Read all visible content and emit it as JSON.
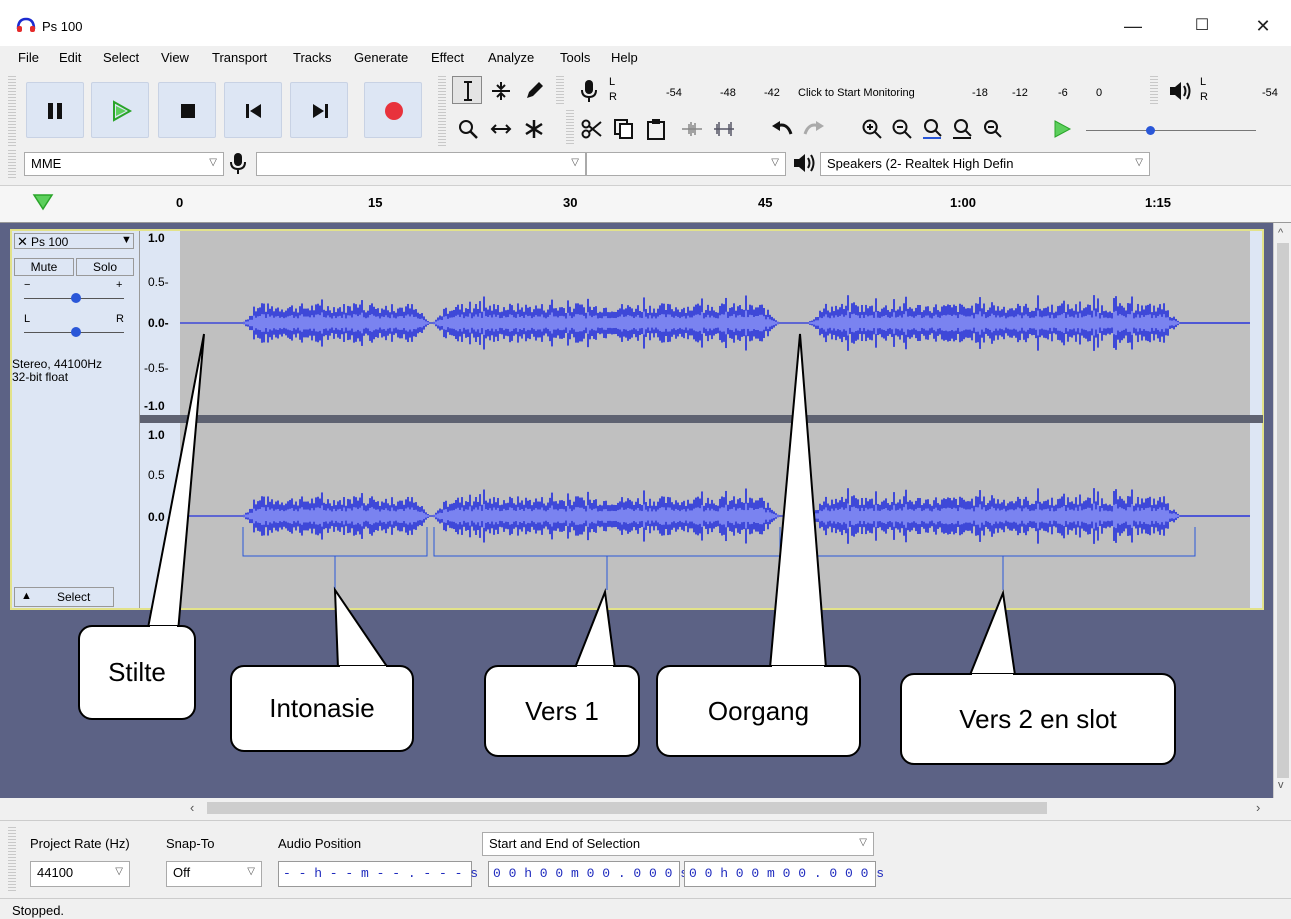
{
  "window": {
    "title": "Ps 100",
    "minimize": "—",
    "maximize": "☐",
    "close": "✕"
  },
  "menu": [
    "File",
    "Edit",
    "Select",
    "View",
    "Transport",
    "Tracks",
    "Generate",
    "Effect",
    "Analyze",
    "Tools",
    "Help"
  ],
  "meters": {
    "record_ticks": [
      "-54",
      "-48",
      "-42",
      "-18",
      "-12",
      "-6",
      "0"
    ],
    "monitor_label": "Click to Start Monitoring",
    "play_ticks": [
      "-54"
    ],
    "lr": [
      "L",
      "R"
    ]
  },
  "device": {
    "host": "MME",
    "input": "",
    "channels": "",
    "output": "Speakers (2- Realtek High Defin"
  },
  "ruler": {
    "ticks": [
      "0",
      "15",
      "30",
      "45",
      "1:00",
      "1:15"
    ]
  },
  "track": {
    "name": "Ps 100",
    "mute": "Mute",
    "solo": "Solo",
    "gain_minus": "−",
    "gain_plus": "+",
    "pan_l": "L",
    "pan_r": "R",
    "info_line1": "Stereo, 44100Hz",
    "info_line2": "32-bit float",
    "select": "Select",
    "scale_top": [
      "1.0",
      "0.5-",
      "0.0-",
      "-0.5-",
      "-1.0"
    ],
    "scale_bottom": [
      "1.0",
      "0.5",
      "0.0",
      "-0"
    ]
  },
  "callouts": [
    "Stilte",
    "Intonasie",
    "Vers 1",
    "Oorgang",
    "Vers 2 en slot"
  ],
  "bottom": {
    "project_rate_label": "Project Rate (Hz)",
    "project_rate_value": "44100",
    "snap_to_label": "Snap-To",
    "snap_to_value": "Off",
    "audio_position_label": "Audio Position",
    "audio_position_value": "- - h - - m - - . - - -  s",
    "selection_label": "Start and End of Selection",
    "selection_start": "0 0 h 0 0 m 0 0 . 0 0 0 s",
    "selection_end": "0 0 h 0 0 m 0 0 . 0 0 0 s"
  },
  "status": {
    "text": "Stopped."
  },
  "colors": {
    "wave": "#3e48d8",
    "wave_light": "#7a83f0",
    "selection_bg": "#dde6f4",
    "track_bg": "#5c6285",
    "border_yellow": "#e2e28a"
  }
}
